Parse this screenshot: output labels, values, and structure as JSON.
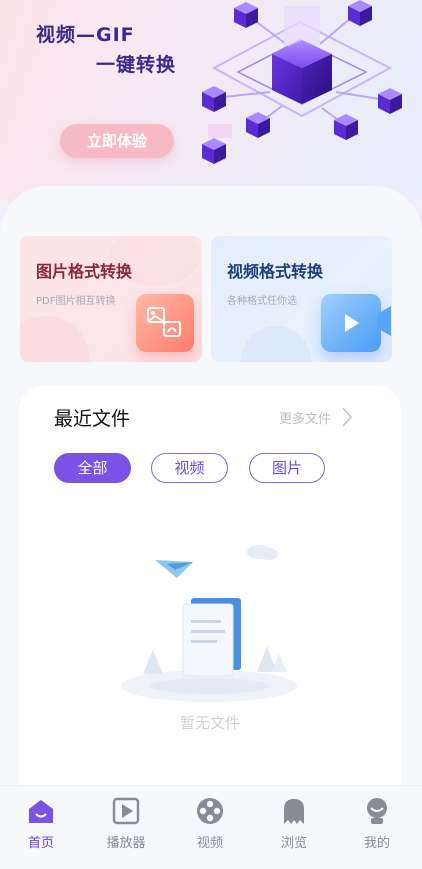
{
  "hero": {
    "title_line1": "视频—GIF",
    "title_line2": "一键转换",
    "button_label": "立即体验"
  },
  "cards": [
    {
      "title": "图片格式转换",
      "subtitle": "PDF图片相互转换",
      "icon": "image-pdf-icon"
    },
    {
      "title": "视频格式转换",
      "subtitle": "各种格式任你选",
      "icon": "video-camera-icon"
    }
  ],
  "recent": {
    "title": "最近文件",
    "more_label": "更多文件",
    "filters": [
      "全部",
      "视频",
      "图片"
    ],
    "selected_filter": "全部",
    "empty_text": "暂无文件"
  },
  "tabbar": {
    "items": [
      {
        "label": "首页",
        "icon": "home-icon",
        "active": true
      },
      {
        "label": "播放器",
        "icon": "play-icon",
        "active": false
      },
      {
        "label": "视频",
        "icon": "film-reel-icon",
        "active": false
      },
      {
        "label": "浏览",
        "icon": "ghost-icon",
        "active": false
      },
      {
        "label": "我的",
        "icon": "profile-icon",
        "active": false
      }
    ]
  },
  "colors": {
    "accent": "#7a52e6",
    "hero_title": "#3b2a8c",
    "hero_button": "#f7b9c4",
    "tab_inactive": "#8b8b96"
  }
}
